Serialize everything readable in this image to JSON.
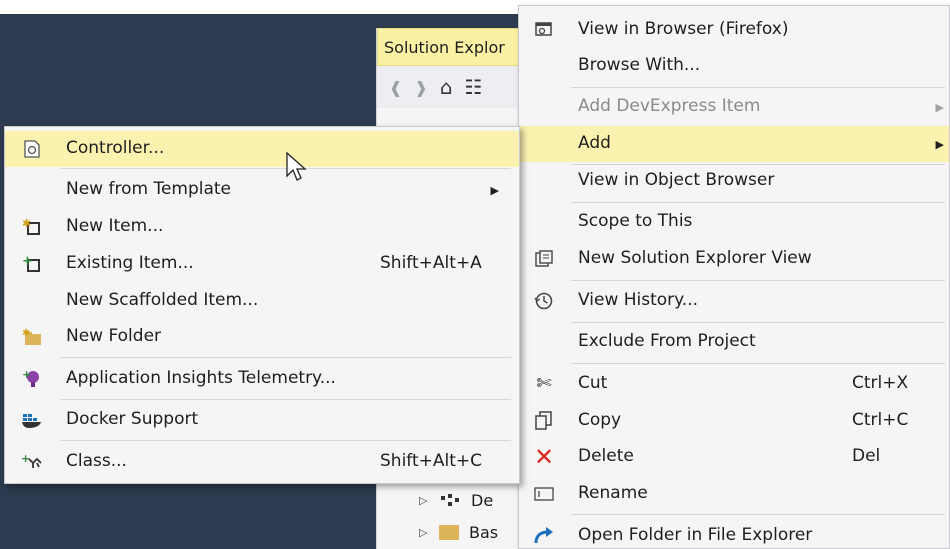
{
  "solution_explorer": {
    "title": "Solution Explor",
    "tree": [
      {
        "label": "De"
      },
      {
        "label": "Bas"
      }
    ]
  },
  "context_menu": {
    "items": [
      {
        "label": "View in Browser (Firefox)",
        "icon": "browser-view-icon"
      },
      {
        "label": "Browse With..."
      },
      {
        "label": "Add DevExpress Item",
        "disabled": true,
        "submenu": true
      },
      {
        "label": "Add",
        "submenu": true,
        "highlighted": true
      },
      {
        "label": "View in Object Browser"
      },
      {
        "label": "Scope to This"
      },
      {
        "label": "New Solution Explorer View",
        "icon": "solution-explorer-view-icon"
      },
      {
        "label": "View History...",
        "icon": "history-icon"
      },
      {
        "label": "Exclude From Project"
      },
      {
        "label": "Cut",
        "shortcut": "Ctrl+X",
        "icon": "scissors-icon"
      },
      {
        "label": "Copy",
        "shortcut": "Ctrl+C",
        "icon": "copy-icon"
      },
      {
        "label": "Delete",
        "shortcut": "Del",
        "icon": "delete-x-icon"
      },
      {
        "label": "Rename",
        "icon": "rename-icon"
      },
      {
        "label": "Open Folder in File Explorer",
        "icon": "open-folder-arrow-icon"
      }
    ]
  },
  "add_submenu": {
    "items": [
      {
        "label": "Controller...",
        "highlighted": true,
        "icon": "controller-icon"
      },
      {
        "label": "New from Template",
        "submenu": true
      },
      {
        "label": "New Item...",
        "icon": "new-item-icon"
      },
      {
        "label": "Existing Item...",
        "shortcut": "Shift+Alt+A",
        "icon": "existing-item-icon"
      },
      {
        "label": "New Scaffolded Item..."
      },
      {
        "label": "New Folder",
        "icon": "new-folder-icon"
      },
      {
        "label": "Application Insights Telemetry...",
        "icon": "insights-bulb-icon"
      },
      {
        "label": "Docker Support",
        "icon": "docker-icon"
      },
      {
        "label": "Class...",
        "shortcut": "Shift+Alt+C",
        "icon": "class-icon"
      }
    ]
  },
  "colors": {
    "highlight": "#fcf2b0",
    "menu_bg": "#f5f5f6",
    "editor_bg": "#2d3a4f",
    "delete_red": "#d9281c",
    "open_blue": "#1f6fbf"
  }
}
